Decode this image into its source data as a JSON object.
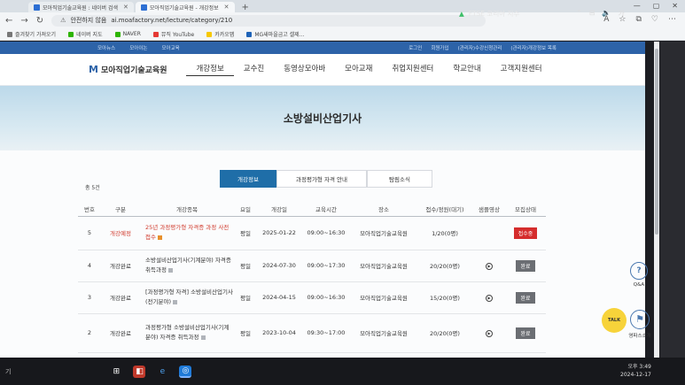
{
  "browser": {
    "tabs": [
      {
        "label": "모아직업기술교육원 : 네이버 검색",
        "active": false
      },
      {
        "label": "모아직업기술교육원 - 개강정보",
        "active": true
      }
    ],
    "new_tab": "+",
    "window_controls": [
      "—",
      "▢",
      "✕"
    ],
    "nav": {
      "back": "←",
      "forward": "→",
      "reload": "↻"
    },
    "url_warning": "안전하지 않음",
    "url": "ai.moafactory.net/lecture/category/210",
    "toolbar_icons": [
      "A",
      "☆",
      "⧉",
      "♡",
      "⋯"
    ],
    "bookmarks": [
      {
        "label": "즐겨찾기 가져오기",
        "color": "#777777"
      },
      {
        "label": "네이버 지도",
        "color": "#2db400"
      },
      {
        "label": "NAVER",
        "color": "#2db400"
      },
      {
        "label": "뮤직 YouTube",
        "color": "#e53935"
      },
      {
        "label": "카카오맵",
        "color": "#f7c800"
      },
      {
        "label": "MG새마을금고 셀제...",
        "color": "#1e63b8"
      }
    ]
  },
  "site": {
    "util_left": [
      "모아뉴스",
      "모아이논",
      "모아교육"
    ],
    "util_right": [
      "로그인",
      "회원가입",
      "(관리자)수강신청관리",
      "(관리자)개강정보 목록"
    ],
    "logo_mark": "M",
    "logo_text": "모아직업기술교육원",
    "menu": [
      "개강정보",
      "교수진",
      "동영상모아바",
      "모아교재",
      "취업지원센터",
      "학교안내",
      "고객지원센터"
    ],
    "hero_title": "소방설비산업기사",
    "subtabs": [
      "개강정보",
      "과정평가형 자격 안내",
      "탐림소식"
    ],
    "count_text": "총 5건",
    "table": {
      "headers": [
        "번호",
        "구분",
        "개강종목",
        "요일",
        "개강일",
        "교육시간",
        "장소",
        "접수/정원(대기)",
        "샘플영상",
        "모집상태"
      ],
      "rows": [
        {
          "no": "5",
          "type": "개강예정",
          "title": "25년 과정평가형 자격증 과정 사전접수",
          "day": "평일",
          "date": "2025-01-22",
          "time": "09:00~16:30",
          "place": "모아직업기술교육원",
          "quota": "1/20(0명)",
          "video": "",
          "status": "접수중"
        },
        {
          "no": "4",
          "type": "개강완료",
          "title": "소방설비산업기사(기계분야) 자격증 취득과정",
          "day": "평일",
          "date": "2024-07-30",
          "time": "09:00~17:30",
          "place": "모아직업기술교육원",
          "quota": "20/20(0명)",
          "video": "▶",
          "status": "완료"
        },
        {
          "no": "3",
          "type": "개강완료",
          "title": "[과정평가형 자격] 소방설비산업기사(전기분야)",
          "day": "평일",
          "date": "2024-04-15",
          "time": "09:00~16:30",
          "place": "모아직업기술교육원",
          "quota": "15/20(0명)",
          "video": "▶",
          "status": "완료"
        },
        {
          "no": "2",
          "type": "개강완료",
          "title": "과정평가형 소방설비산업기사(기계분야) 자격증 취득과정",
          "day": "평일",
          "date": "2023-10-04",
          "time": "09:30~17:00",
          "place": "모아직업기술교육원",
          "quota": "20/20(0명)",
          "video": "▶",
          "status": "완료"
        }
      ]
    },
    "float": {
      "qa_label": "Q&A",
      "qa_icon": "?",
      "talk_label": "TALK",
      "guide_label": "영파스소개",
      "guide_icon": "⚑"
    }
  },
  "taskbar": {
    "search": "기",
    "icons": [
      "⊞",
      "◧",
      "e",
      "◎"
    ],
    "ticker_label": "FTSE 코리아 지수",
    "ticker_arrow": "▲",
    "tray": [
      "⌃",
      "⊟",
      "🔈",
      "가"
    ],
    "time": "오후 3:49",
    "date": "2024-12-17"
  },
  "colors": {
    "brand_blue": "#2d63a8",
    "tab_active": "#1f6ea8",
    "status_open": "#d52d2d",
    "status_done": "#6b6e73"
  }
}
